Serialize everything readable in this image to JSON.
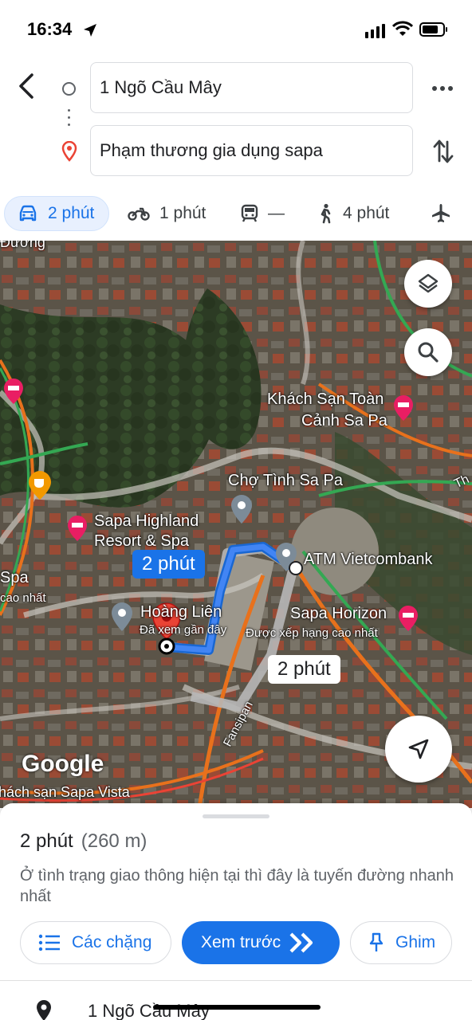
{
  "status_bar": {
    "time": "16:34"
  },
  "directions": {
    "origin": "1 Ngõ Cầu Mây",
    "destination": "Phạm thương gia dụng sapa"
  },
  "modes": [
    {
      "name": "driving",
      "label": "2 phút",
      "active": true
    },
    {
      "name": "motorbike",
      "label": "1 phút",
      "active": false
    },
    {
      "name": "transit",
      "label": "—",
      "active": false
    },
    {
      "name": "walking",
      "label": "4 phút",
      "active": false
    },
    {
      "name": "flight",
      "label": "",
      "active": false
    }
  ],
  "map": {
    "labels": {
      "khach_san_toan_canh_1": "Khách Sạn Toàn",
      "khach_san_toan_canh_2": "Cảnh Sa Pa",
      "cho_tinh": "Chợ Tình Sa Pa",
      "sapa_highland_1": "Sapa Highland",
      "sapa_highland_2": "Resort & Spa",
      "atm": "ATM Vietcombank",
      "sapa_horizon": "Sapa Horizon",
      "sapa_horizon_sub": "Được xếp hạng cao nhất",
      "hoang_lien": "Hoàng Liên",
      "hoang_lien_sub": "Đã xem gần đây",
      "left_spa": "Spa",
      "left_sub": "cao nhất",
      "fansipan": "Fansipan",
      "sapa_vista": "Khách sạn Sapa Vista",
      "duong": "Đường",
      "right_road": "Th"
    },
    "route_badge_primary": "2 phút",
    "route_badge_alt": "2 phút",
    "watermark": "Google"
  },
  "sheet": {
    "duration": "2 phút",
    "distance": "(260 m)",
    "description": "Ở tình trạng giao thông hiện tại thì đây là tuyến đường nhanh nhất",
    "steps_button": "Các chặng",
    "preview_button": "Xem trước",
    "pin_button": "Ghim",
    "first_step": "1 Ngõ Cầu Mây"
  },
  "colors": {
    "accent": "#1a73e8",
    "route": "#4285f4",
    "destination_pin": "#ea4335"
  }
}
